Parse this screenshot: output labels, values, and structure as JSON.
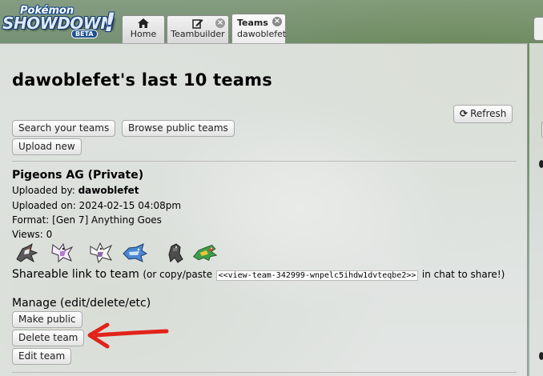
{
  "header": {
    "logo": {
      "top": "Pokémon",
      "main": "SHOWDOWN",
      "badge": "BETA",
      "bang": "!"
    },
    "tabs": [
      {
        "label": "Home",
        "icon": "home-icon"
      },
      {
        "label": "Teambuilder",
        "icon": "edit-icon"
      },
      {
        "title": "Teams",
        "subtitle": "dawoblefet",
        "active": true
      }
    ]
  },
  "page": {
    "title": "dawoblefet's last 10 teams",
    "refresh_label": "Refresh",
    "buttons": {
      "search": "Search your teams",
      "browse": "Browse public teams",
      "upload": "Upload new"
    }
  },
  "team": {
    "name": "Pigeons AG (Private)",
    "uploaded_by_label": "Uploaded by:",
    "uploaded_by": "dawoblefet",
    "uploaded_on": "Uploaded on: 2024-02-15 04:08pm",
    "format": "Format: [Gen 7] Anything Goes",
    "views": "Views: 0",
    "pokemon_icons": [
      "pokemon-sprite-1",
      "pokemon-sprite-2",
      "pokemon-sprite-3",
      "pokemon-sprite-4",
      "pokemon-sprite-5",
      "pokemon-sprite-6"
    ],
    "share": {
      "label": "Shareable link to team",
      "hint_prefix": "(or copy/paste",
      "code": "<<view-team-342999-wnpelc5ihdw1dvteqbe2>>",
      "hint_suffix": "in chat to share!)"
    },
    "manage_label": "Manage (edit/delete/etc)",
    "actions": {
      "make_public": "Make public",
      "delete": "Delete team",
      "edit": "Edit team"
    }
  },
  "colors": {
    "annotation_arrow": "#e2231a",
    "logo_blue": "#1d4e8f"
  }
}
